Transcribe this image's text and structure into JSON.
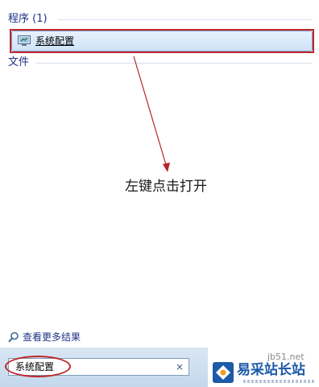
{
  "start_menu": {
    "programs_header": "程序 (1)",
    "result_item_label": "系统配置",
    "files_header": "文件",
    "see_more_label": "查看更多结果"
  },
  "annotation": {
    "text": "左键点击打开",
    "color": "#c0272d"
  },
  "search": {
    "value": "系统配置",
    "clear_icon": "×"
  },
  "watermark": {
    "url": "jb51.net",
    "name": "易采站长站"
  },
  "icons": {
    "result": "msconfig-icon",
    "see_more": "search-icon",
    "clear": "clear-icon",
    "logo": "site-logo-icon"
  }
}
